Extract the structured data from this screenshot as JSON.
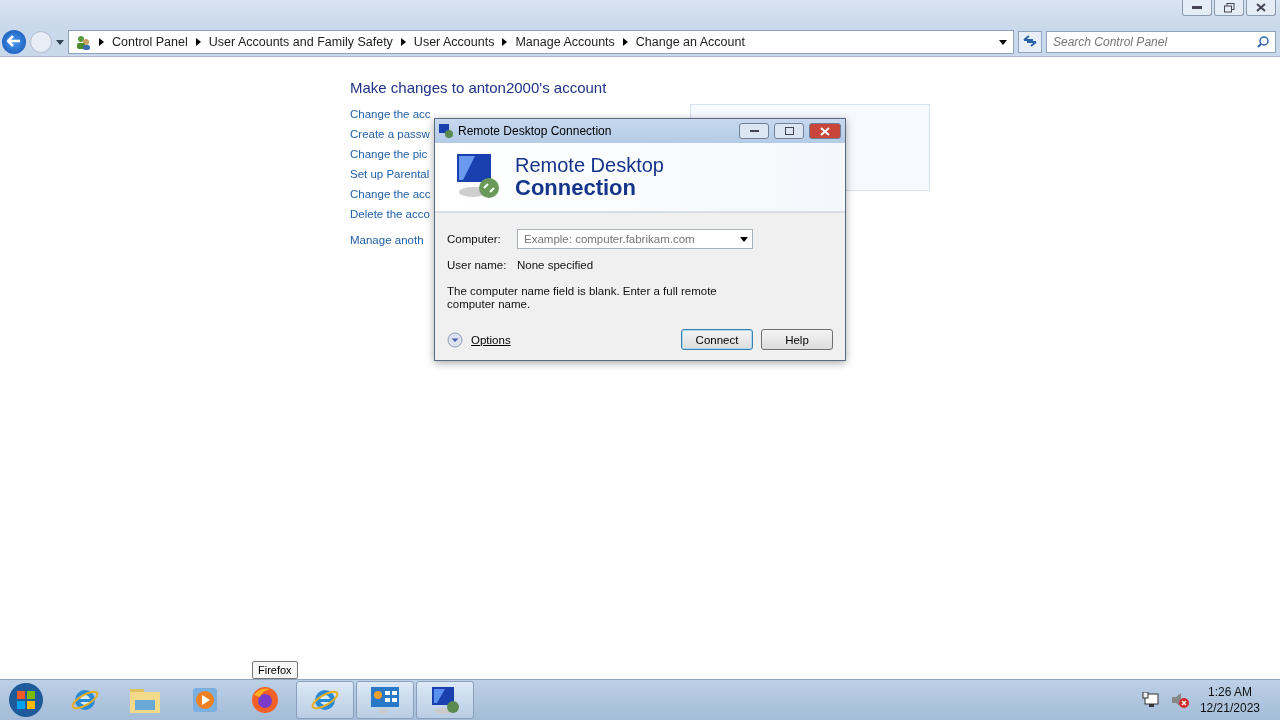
{
  "explorer": {
    "breadcrumb": [
      "Control Panel",
      "User Accounts and Family Safety",
      "User Accounts",
      "Manage Accounts",
      "Change an Account"
    ],
    "search": {
      "placeholder": "Search Control Panel"
    },
    "heading": "Make changes to anton2000's account",
    "links": [
      "Change the acc",
      "Create a passw",
      "Change the pic",
      "Set up Parental",
      "Change the acc",
      "Delete the acco"
    ],
    "secondary_link": "Manage anoth"
  },
  "dialog": {
    "title": "Remote Desktop Connection",
    "banner_line_1": "Remote Desktop",
    "banner_line_2": "Connection",
    "computer_label": "Computer:",
    "computer_placeholder": "Example: computer.fabrikam.com",
    "user_label": "User name:",
    "user_value": "None specified",
    "message": "The computer name field is blank. Enter a full remote computer name.",
    "options": "Options",
    "buttons": [
      "Connect",
      "Help"
    ]
  },
  "tooltip": "Firefox",
  "taskbar": {
    "items": [
      {
        "kind": "ie",
        "running": false
      },
      {
        "kind": "folder",
        "running": false
      },
      {
        "kind": "media",
        "running": false
      },
      {
        "kind": "firefox",
        "running": false
      },
      {
        "kind": "ie",
        "running": true
      },
      {
        "kind": "panel",
        "running": true
      },
      {
        "kind": "monitor",
        "running": true
      }
    ],
    "time": "1:26 AM",
    "date": "12/21/2023"
  }
}
